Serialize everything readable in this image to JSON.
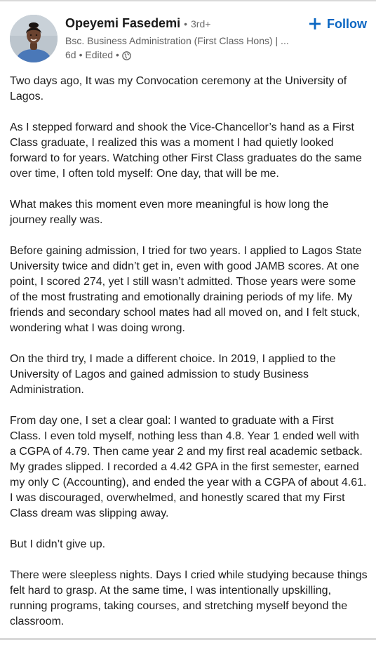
{
  "author": {
    "name": "Opeyemi Fasedemi",
    "degree_separator": "•",
    "degree": "3rd+",
    "headline": "Bsc. Business Administration (First Class Hons) | ...",
    "time": "6d",
    "edited": "• Edited •",
    "visibility_icon": "globe-icon"
  },
  "follow_button": {
    "icon": "plus-icon",
    "label": "Follow"
  },
  "colors": {
    "accent": "#0a66c2",
    "text": "#202020",
    "secondary_text": "#666666"
  },
  "post": {
    "paragraphs": [
      "Two days ago, It was my Convocation ceremony at the University of Lagos.",
      "As I stepped forward and shook the Vice-Chancellor’s hand as a First Class graduate, I realized this was a moment I had quietly looked forward to for years. Watching other First Class graduates do the same over time, I often told myself: One day, that will be me.",
      "What makes this moment even more meaningful is how long the journey really was.",
      "Before gaining admission, I tried for two years. I applied to Lagos State University twice and didn’t get in, even with good JAMB scores. At one point, I scored 274, yet I still wasn’t admitted. Those years were some of the most frustrating and emotionally draining periods of my life. My friends and secondary school mates had all moved on, and I felt stuck, wondering what I was doing wrong.",
      "On the third try, I made a different choice. In 2019, I applied to the University of Lagos and gained admission to study Business Administration.",
      "From day one, I set a clear goal: I wanted to graduate with a First Class. I even told myself, nothing less than 4.8. Year 1 ended well with a CGPA of 4.79. Then came year 2 and my first real academic setback. My grades slipped. I recorded a 4.42 GPA in the first semester, earned my only C (Accounting), and ended the year with a CGPA of about 4.61. I was discouraged, overwhelmed, and honestly scared that my First Class dream was slipping away.",
      "But I didn’t give up.",
      "There were sleepless nights. Days I cried while studying because things felt hard to grasp. At the same time, I was intentionally upskilling, running programs, taking courses, and stretching myself beyond the classroom."
    ]
  }
}
